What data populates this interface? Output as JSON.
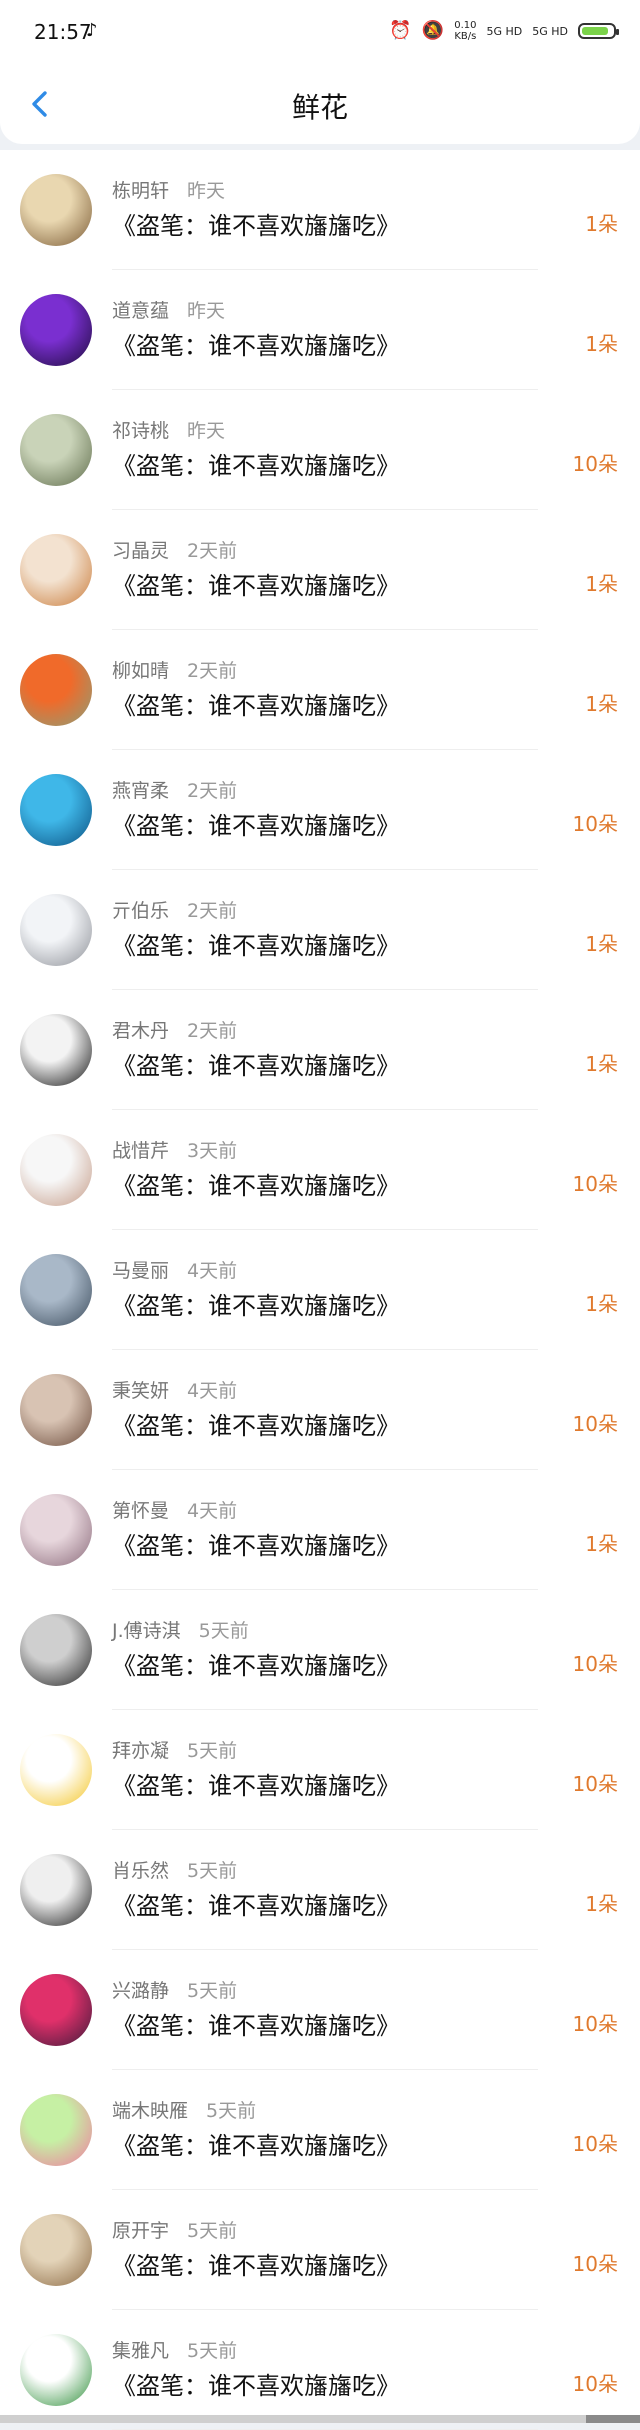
{
  "status_bar": {
    "time": "21:57",
    "music_icon": "♪",
    "alarm_icon": "⏰",
    "mute_icon": "🔕",
    "net_speed_top": "0.10",
    "net_speed_bottom": "KB/s",
    "signal_1": "5G HD",
    "signal_2": "5G HD"
  },
  "header": {
    "title": "鲜花",
    "back_icon": "chevron-left-icon"
  },
  "colors": {
    "accent": "#2f8be6",
    "count": "#e07a2e",
    "name": "#777777",
    "battery": "#7bd34a"
  },
  "flowers": [
    {
      "name": "栋明轩",
      "time": "昨天",
      "message": "《盗笔：谁不喜欢旛旛吃》",
      "count": "1朵",
      "avatar": {
        "c1": "#e9d7b0",
        "c2": "#7a5a34"
      }
    },
    {
      "name": "道意蕴",
      "time": "昨天",
      "message": "《盗笔：谁不喜欢旛旛吃》",
      "count": "1朵",
      "avatar": {
        "c1": "#7a2fd0",
        "c2": "#1c0b3a"
      }
    },
    {
      "name": "祁诗桃",
      "time": "昨天",
      "message": "《盗笔：谁不喜欢旛旛吃》",
      "count": "10朵",
      "avatar": {
        "c1": "#c9d3b8",
        "c2": "#5e6b4a"
      }
    },
    {
      "name": "习晶灵",
      "time": "2天前",
      "message": "《盗笔：谁不喜欢旛旛吃》",
      "count": "1朵",
      "avatar": {
        "c1": "#f3e2d0",
        "c2": "#c97b3a"
      }
    },
    {
      "name": "柳如晴",
      "time": "2天前",
      "message": "《盗笔：谁不喜欢旛旛吃》",
      "count": "1朵",
      "avatar": {
        "c1": "#f06a2a",
        "c2": "#8aa07a"
      }
    },
    {
      "name": "燕宵柔",
      "time": "2天前",
      "message": "《盗笔：谁不喜欢旛旛吃》",
      "count": "10朵",
      "avatar": {
        "c1": "#3fb7e8",
        "c2": "#0a4f80"
      }
    },
    {
      "name": "亓伯乐",
      "time": "2天前",
      "message": "《盗笔：谁不喜欢旛旛吃》",
      "count": "1朵",
      "avatar": {
        "c1": "#f2f4f7",
        "c2": "#8c8f96"
      }
    },
    {
      "name": "君木丹",
      "time": "2天前",
      "message": "《盗笔：谁不喜欢旛旛吃》",
      "count": "1朵",
      "avatar": {
        "c1": "#f3f3f3",
        "c2": "#111111"
      }
    },
    {
      "name": "战惜芹",
      "time": "3天前",
      "message": "《盗笔：谁不喜欢旛旛吃》",
      "count": "10朵",
      "avatar": {
        "c1": "#f7f7f7",
        "c2": "#c49a86"
      }
    },
    {
      "name": "马曼丽",
      "time": "4天前",
      "message": "《盗笔：谁不喜欢旛旛吃》",
      "count": "1朵",
      "avatar": {
        "c1": "#a9b8c8",
        "c2": "#3a4a5a"
      }
    },
    {
      "name": "秉笑妍",
      "time": "4天前",
      "message": "《盗笔：谁不喜欢旛旛吃》",
      "count": "10朵",
      "avatar": {
        "c1": "#d8c3b3",
        "c2": "#6a4a3a"
      }
    },
    {
      "name": "第怀曼",
      "time": "4天前",
      "message": "《盗笔：谁不喜欢旛旛吃》",
      "count": "1朵",
      "avatar": {
        "c1": "#e7d6dc",
        "c2": "#8a6a7a"
      }
    },
    {
      "name": "J.傅诗淇",
      "time": "5天前",
      "message": "《盗笔：谁不喜欢旛旛吃》",
      "count": "10朵",
      "avatar": {
        "c1": "#cfcfcf",
        "c2": "#222222"
      }
    },
    {
      "name": "拜亦凝",
      "time": "5天前",
      "message": "《盗笔：谁不喜欢旛旛吃》",
      "count": "10朵",
      "avatar": {
        "c1": "#ffffff",
        "c2": "#f3c423"
      }
    },
    {
      "name": "肖乐然",
      "time": "5天前",
      "message": "《盗笔：谁不喜欢旛旛吃》",
      "count": "1朵",
      "avatar": {
        "c1": "#efefef",
        "c2": "#1a1a1a"
      }
    },
    {
      "name": "兴潞静",
      "time": "5天前",
      "message": "《盗笔：谁不喜欢旛旛吃》",
      "count": "10朵",
      "avatar": {
        "c1": "#e0306a",
        "c2": "#3b1a3a"
      }
    },
    {
      "name": "端木映雁",
      "time": "5天前",
      "message": "《盗笔：谁不喜欢旛旛吃》",
      "count": "10朵",
      "avatar": {
        "c1": "#c6f0a4",
        "c2": "#f07aa0"
      }
    },
    {
      "name": "原开宇",
      "time": "5天前",
      "message": "《盗笔：谁不喜欢旛旛吃》",
      "count": "10朵",
      "avatar": {
        "c1": "#e3d3b8",
        "c2": "#8c6a44"
      }
    },
    {
      "name": "集雅凡",
      "time": "5天前",
      "message": "《盗笔：谁不喜欢旛旛吃》",
      "count": "10朵",
      "avatar": {
        "c1": "#ffffff",
        "c2": "#2f8f3a"
      }
    }
  ]
}
